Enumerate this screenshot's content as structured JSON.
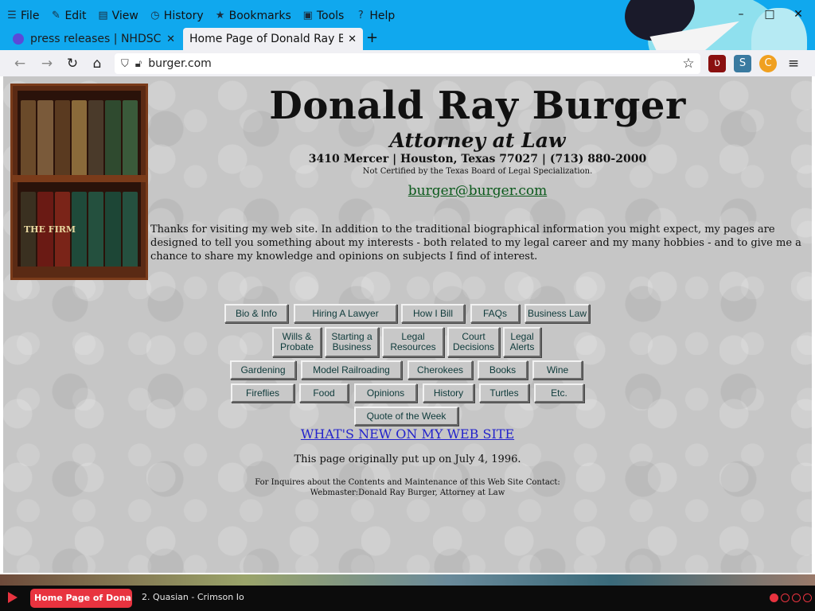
{
  "menubar": {
    "items": [
      {
        "label": "File",
        "icon": "file-icon",
        "glyph": "☰"
      },
      {
        "label": "Edit",
        "icon": "pencil-icon",
        "glyph": "✎"
      },
      {
        "label": "View",
        "icon": "view-icon",
        "glyph": "▤"
      },
      {
        "label": "History",
        "icon": "history-icon",
        "glyph": "◷"
      },
      {
        "label": "Bookmarks",
        "icon": "star-icon",
        "glyph": "★"
      },
      {
        "label": "Tools",
        "icon": "toolbox-icon",
        "glyph": "▣"
      },
      {
        "label": "Help",
        "icon": "help-icon",
        "glyph": "?"
      }
    ]
  },
  "window_controls": {
    "minimize": "–",
    "restore": "□",
    "close": "✕"
  },
  "tabs": {
    "inactive": {
      "title": "press releases | NHDSC",
      "close": "✕"
    },
    "active": {
      "title": "Home Page of Donald Ray Bu",
      "close": "✕"
    },
    "new_tab": "+"
  },
  "navbar": {
    "back": "←",
    "forward": "→",
    "reload": "↻",
    "home": "⌂",
    "url": "burger.com",
    "bookmark_star": "☆",
    "ext_ublock": "ʋ",
    "ext_s": "S",
    "ext_c": "C",
    "menu": "≡"
  },
  "page": {
    "title": "Donald Ray Burger",
    "subtitle": "Attorney at Law",
    "address": "3410 Mercer | Houston, Texas 77027 | (713) 880-2000",
    "not_certified": "Not Certified by the Texas Board of Legal Specialization.",
    "email": "burger@burger.com",
    "intro": "Thanks for visiting my web site. In addition to the traditional biographical information you might expect, my pages are designed to tell you something about my interests - both related to my legal career and my many hobbies - and to give me a chance to share my knowledge and opinions on subjects I find of interest.",
    "bookcase_label": "THE FIRM",
    "buttons": {
      "row1": [
        "Bio & Info",
        "Hiring A Lawyer",
        "How I Bill",
        "FAQs",
        "Business Law"
      ],
      "row2": [
        "Wills & Probate",
        "Starting a Business",
        "Legal Resources",
        "Court Decisions",
        "Legal Alerts"
      ],
      "row3": [
        "Gardening",
        "Model Railroading",
        "Cherokees",
        "Books",
        "Wine"
      ],
      "row4": [
        "Fireflies",
        "Food",
        "Opinions",
        "History",
        "Turtles",
        "Etc."
      ],
      "row5": [
        "Quote of the Week"
      ]
    },
    "whats_new": "WHAT'S NEW ON MY WEB SITE",
    "original_date": "This page originally put up on July 4, 1996.",
    "footer_line1": "For Inquires about the Contents and Maintenance of this Web Site Contact:",
    "footer_line2": "Webmaster:Donald Ray Burger, Attorney at Law"
  },
  "taskbar": {
    "active_window": "Home Page of Donal",
    "track": "2. Quasian - Crimson Io"
  },
  "colors": {
    "firefox_accent": "#10a8ee",
    "page_bg": "#c6c6c6",
    "email_link": "#0b5a1c",
    "whats_new_link": "#2222cc",
    "taskbar_accent": "#e8333f"
  }
}
